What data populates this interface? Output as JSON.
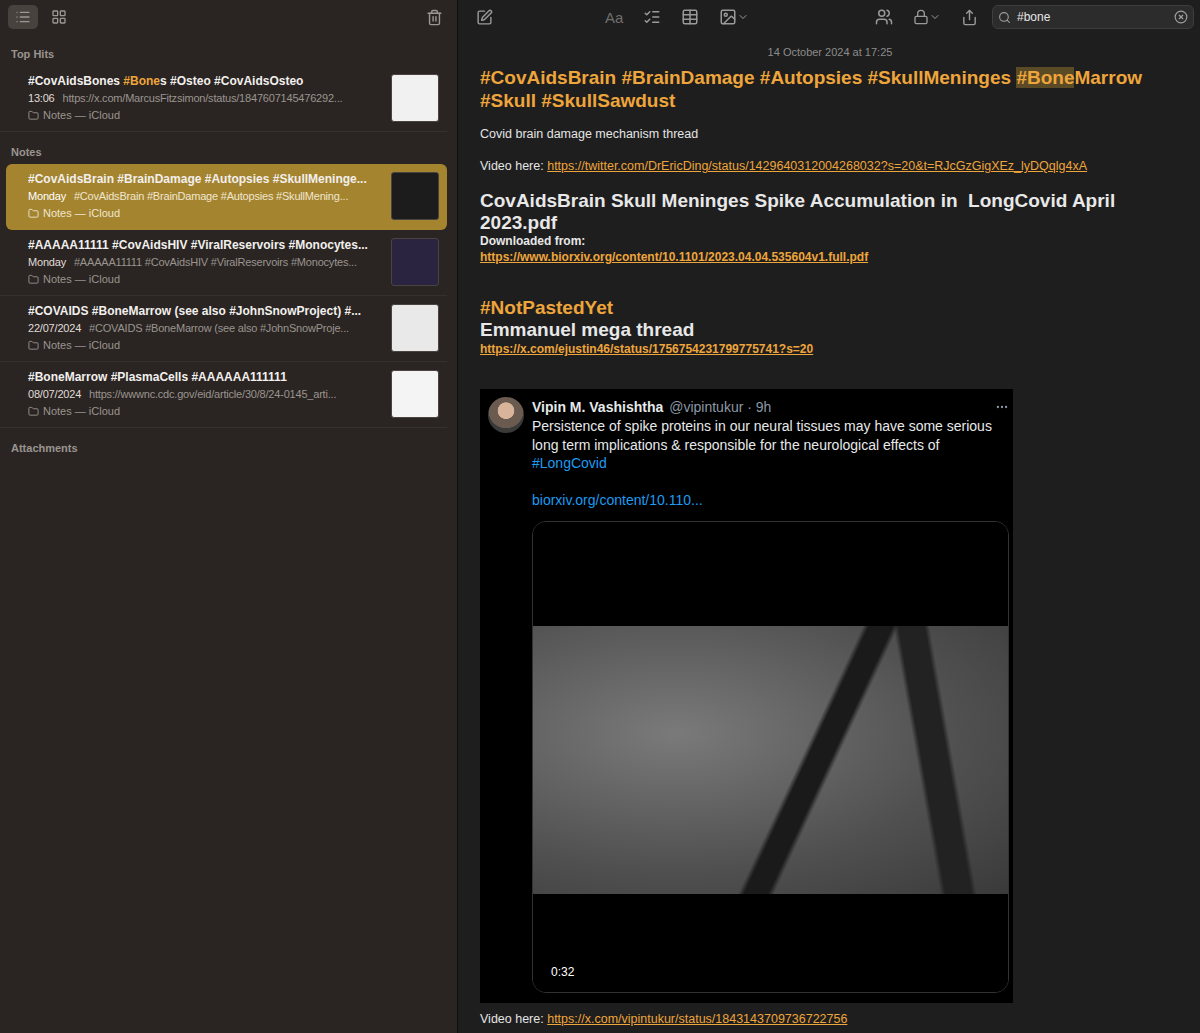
{
  "sidebar": {
    "view_modes": [
      {
        "name": "list",
        "selected": true
      },
      {
        "name": "gallery",
        "selected": false
      }
    ],
    "sections": [
      {
        "heading": "Top Hits",
        "notes": [
          {
            "title": [
              {
                "text": "#CovAidsBones ",
                "highlight": false
              },
              {
                "text": "#Bone",
                "highlight": true
              },
              {
                "text": "s #Osteo #CovAidsOsteo",
                "highlight": false
              }
            ],
            "date": "13:06",
            "preview": "https://x.com/MarcusFitzsimon/status/1847607145476292...",
            "folder": "Notes — iCloud",
            "selected": false,
            "color": "#f1f1f1"
          }
        ]
      },
      {
        "heading": "Notes",
        "notes": [
          {
            "title": [
              {
                "text": "#CovAidsBrain #BrainDamage #Autopsies #SkullMeninge...",
                "highlight": false
              }
            ],
            "date": "Monday",
            "preview": "#CovAidsBrain #BrainDamage #Autopsies #SkullMening...",
            "folder": "Notes — iCloud",
            "selected": true,
            "color": "#1c1c1c"
          },
          {
            "title": [
              {
                "text": "#AAAAA11111 #CovAidsHIV #ViralReservoirs #Monocytes...",
                "highlight": false
              }
            ],
            "date": "Monday",
            "preview": "#AAAAA11111 #CovAidsHIV #ViralReservoirs #Monocytes...",
            "folder": "Notes — iCloud",
            "selected": false,
            "color": "#2a2440"
          },
          {
            "title": [
              {
                "text": "#COVAIDS #BoneMarrow (see also #JohnSnowProject) #...",
                "highlight": false
              }
            ],
            "date": "22/07/2024",
            "preview": "#COVAIDS #BoneMarrow (see also #JohnSnowProje...",
            "folder": "Notes — iCloud",
            "selected": false,
            "color": "#e9e9e9"
          },
          {
            "title": [
              {
                "text": "#BoneMarrow #PlasmaCells #AAAAAA111111",
                "highlight": false
              }
            ],
            "date": "08/07/2024",
            "preview": "https://wwwnc.cdc.gov/eid/article/30/8/24-0145_arti...",
            "folder": "Notes — iCloud",
            "selected": false,
            "color": "#f4f4f4"
          }
        ]
      },
      {
        "heading": "Attachments",
        "notes": []
      }
    ]
  },
  "toolbar": {
    "format_label": "Aa"
  },
  "search": {
    "value": "#bone"
  },
  "note": {
    "date": "14 October 2024 at 17:25",
    "title": [
      {
        "text": "#CovAidsBrain #BrainDamage #Autopsies #SkullMeninges ",
        "highlight": false
      },
      {
        "text": "#Bone",
        "highlight": true
      },
      {
        "text": "Marrow #Skull #SkullSawdust",
        "highlight": false
      }
    ],
    "blocks": [
      {
        "kind": "text",
        "text": "Covid brain damage mechanism thread"
      },
      {
        "kind": "blank"
      },
      {
        "kind": "link-line",
        "label": "Video here: ",
        "url": "https://twitter.com/DrEricDing/status/1429640312004268032?s=20&t=RJcGzGigXEz_lyDQqlg4xA"
      },
      {
        "kind": "blank"
      },
      {
        "kind": "heading",
        "text": "CovAidsBrain Skull Meninges Spike Accumulation in  LongCovid April 2023.pdf"
      },
      {
        "kind": "label",
        "text": "Downloaded from:"
      },
      {
        "kind": "link",
        "url": "https://www.biorxiv.org/content/10.1101/2023.04.04.535604v1.full.pdf"
      },
      {
        "kind": "blank"
      },
      {
        "kind": "blank"
      },
      {
        "kind": "tag-heading",
        "text": "#NotPastedYet"
      },
      {
        "kind": "heading",
        "text": "Emmanuel mega thread"
      },
      {
        "kind": "link",
        "url": "https://x.com/ejustin46/status/1756754231799775741?s=20"
      },
      {
        "kind": "blank"
      },
      {
        "kind": "blank"
      },
      {
        "kind": "tweet",
        "author": "Vipin M. Vashishtha",
        "handle": "@vipintukur · 9h",
        "text": "Persistence of spike proteins in our neural tissues may have some serious long term implications & responsible for the neurological effects of",
        "hashtag": "#LongCovid",
        "link": "biorxiv.org/content/10.110...",
        "duration": "0:32"
      },
      {
        "kind": "link-line",
        "label": "Video here: ",
        "url": "https://x.com/vipintukur/status/1843143709736722756"
      }
    ]
  }
}
